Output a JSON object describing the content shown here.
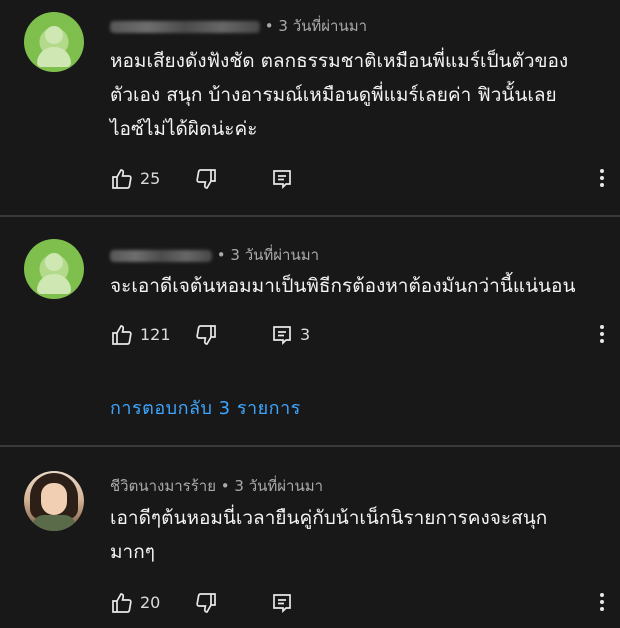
{
  "comments": [
    {
      "avatar": "blurred-default-avatar",
      "time": "• 3 วันที่ผ่านมา",
      "text_lines": [
        "หอมเสียงดังฟังชัด ตลกธรรมชาติเหมือนพี่แมร์เป็นตัวของ",
        "ตัวเอง สนุก บ้างอารมณ์เหมือนดูพี่แมร์เลยค่า ฟิวนั้นเลย",
        "ไอซ์ไม่ได้ผิดน่ะค่ะ"
      ],
      "likes": "25",
      "replies_count": ""
    },
    {
      "avatar": "blurred-default-avatar",
      "time": "• 3 วันที่ผ่านมา",
      "text_lines": [
        "จะเอาดีเจต้นหอมมาเป็นพิธีกรต้องหาต้องมันกว่านี้แน่นอน"
      ],
      "likes": "121",
      "replies_count": "3",
      "view_replies": "การตอบกลับ 3 รายการ"
    },
    {
      "avatar": "user-photo",
      "name": "ชีวิตนางมารร้าย",
      "time": "• 3 วันที่ผ่านมา",
      "text_lines": [
        "เอาดีๆต้นหอมนี่เวลายืนคู่กับน้าเน็กนิรายการคงจะสนุก",
        "มากๆ"
      ],
      "likes": "20",
      "replies_count": ""
    }
  ],
  "icons": {
    "like": "thumb-up-icon",
    "dislike": "thumb-down-icon",
    "reply": "reply-icon",
    "more": "more-vert-icon"
  },
  "colors": {
    "background": "#181818",
    "link": "#3ea6ff",
    "meta": "#aaaaaa"
  }
}
